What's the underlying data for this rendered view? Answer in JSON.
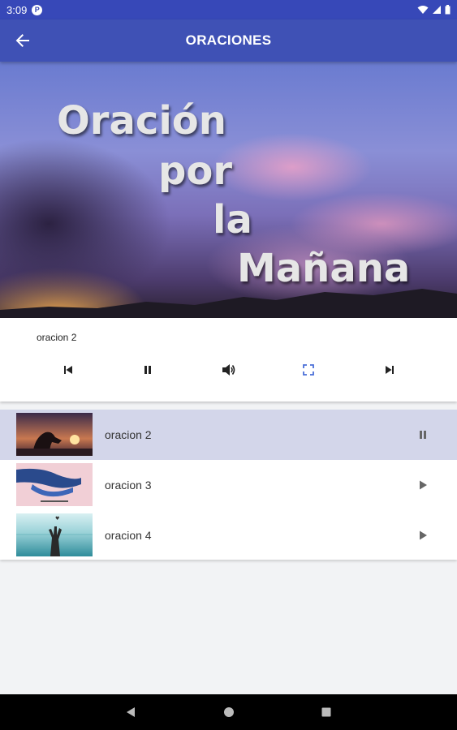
{
  "status_bar": {
    "time": "3:09",
    "notification_badge": "P"
  },
  "app_bar": {
    "title": "ORACIONES",
    "back_icon": "arrow-back-icon"
  },
  "hero": {
    "lines": [
      "Oración",
      "por",
      "la",
      "Mañana"
    ]
  },
  "player": {
    "current_track": "oracion 2",
    "controls": [
      "skip-previous-icon",
      "pause-icon",
      "volume-icon",
      "fullscreen-icon",
      "skip-next-icon"
    ],
    "accent_color": "#4a6fd8"
  },
  "playlist": {
    "items": [
      {
        "label": "oracion 2",
        "state": "playing",
        "icon": "pause-icon"
      },
      {
        "label": "oracion 3",
        "state": "idle",
        "icon": "play-icon"
      },
      {
        "label": "oracion 4",
        "state": "idle",
        "icon": "play-icon"
      }
    ]
  },
  "colors": {
    "app_bar": "#3f51b5",
    "status_bar": "#3748b8",
    "active_row": "#d3d6ea"
  }
}
